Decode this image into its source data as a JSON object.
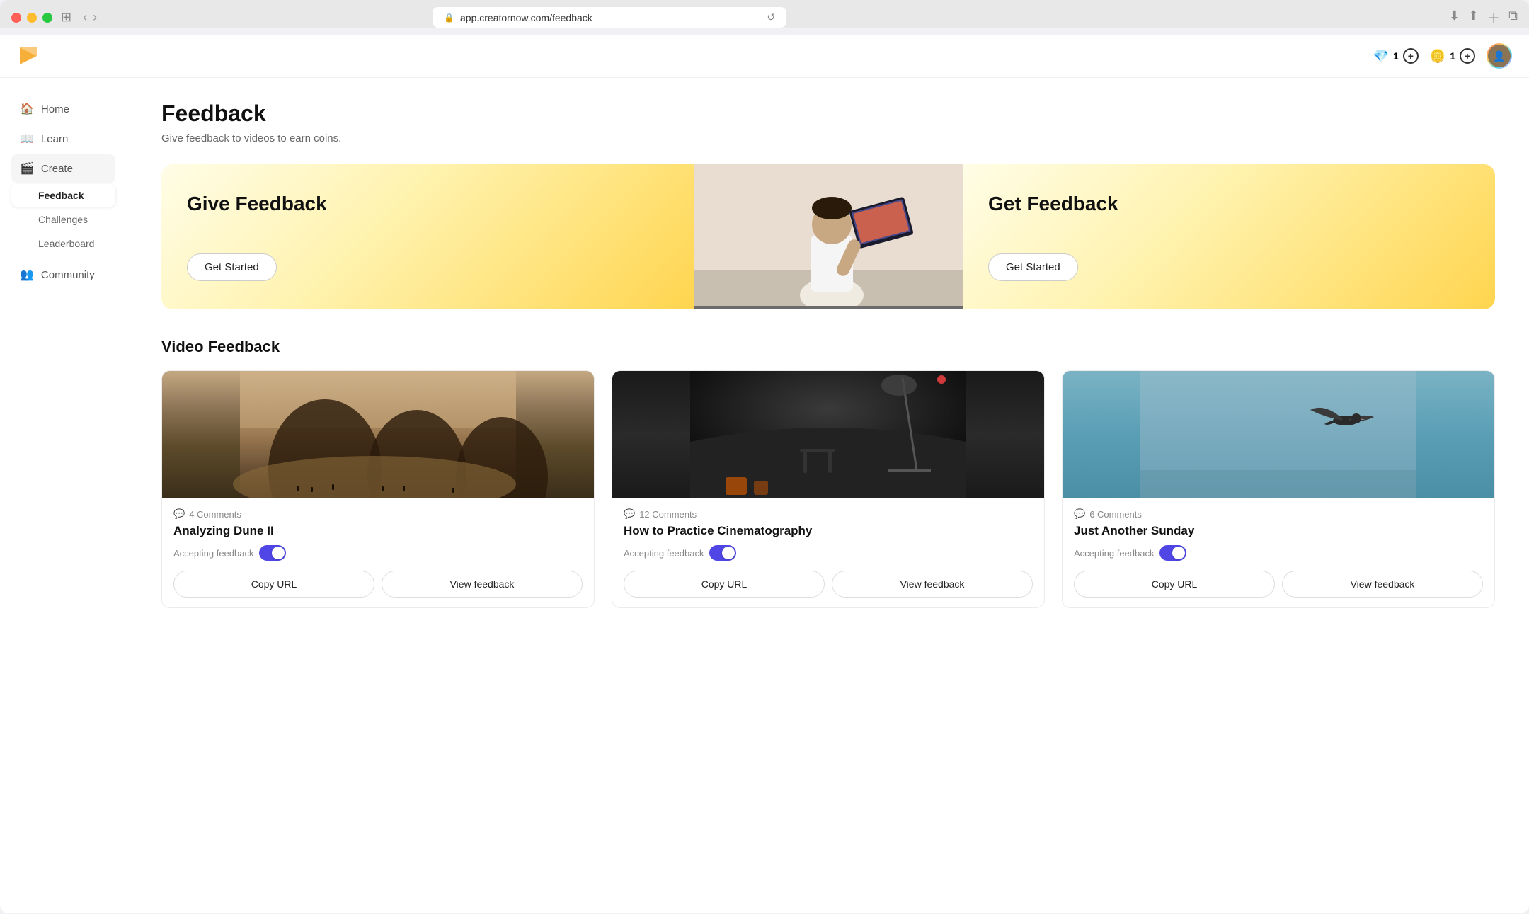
{
  "browser": {
    "url": "app.creatornow.com/feedback",
    "reload_label": "↺"
  },
  "header": {
    "logo_alt": "CreatorNow",
    "gem_count": "1",
    "coin_count": "1",
    "gem_add_label": "+",
    "coin_add_label": "+"
  },
  "sidebar": {
    "items": [
      {
        "id": "home",
        "label": "Home",
        "icon": "🏠"
      },
      {
        "id": "learn",
        "label": "Learn",
        "icon": "📖"
      },
      {
        "id": "create",
        "label": "Create",
        "icon": "🎬"
      }
    ],
    "sub_items": [
      {
        "id": "feedback",
        "label": "Feedback",
        "active": true
      },
      {
        "id": "challenges",
        "label": "Challenges",
        "active": false
      },
      {
        "id": "leaderboard",
        "label": "Leaderboard",
        "active": false
      }
    ],
    "community": {
      "label": "Community",
      "icon": "👥"
    }
  },
  "page": {
    "title": "Feedback",
    "subtitle": "Give feedback to videos to earn coins."
  },
  "hero": {
    "give": {
      "title": "Give Feedback",
      "btn_label": "Get Started"
    },
    "get": {
      "title": "Get Feedback",
      "btn_label": "Get Started"
    }
  },
  "video_section": {
    "title": "Video Feedback",
    "videos": [
      {
        "id": "v1",
        "thumb_type": "dune",
        "comments_count": "4 Comments",
        "title": "Analyzing Dune II",
        "toggle_label": "Accepting feedback",
        "copy_btn": "Copy URL",
        "view_btn": "View feedback"
      },
      {
        "id": "v2",
        "thumb_type": "cinema",
        "comments_count": "12 Comments",
        "title": "How to Practice Cinematography",
        "toggle_label": "Accepting feedback",
        "copy_btn": "Copy URL",
        "view_btn": "View feedback"
      },
      {
        "id": "v3",
        "thumb_type": "bird",
        "comments_count": "6 Comments",
        "title": "Just Another Sunday",
        "toggle_label": "Accepting feedback",
        "copy_btn": "Copy URL",
        "view_btn": "View feedback"
      }
    ]
  },
  "icons": {
    "home": "🏠",
    "learn": "📖",
    "create": "🎬",
    "community": "👥",
    "comment": "💬",
    "gem": "💎",
    "coin": "🪙"
  }
}
